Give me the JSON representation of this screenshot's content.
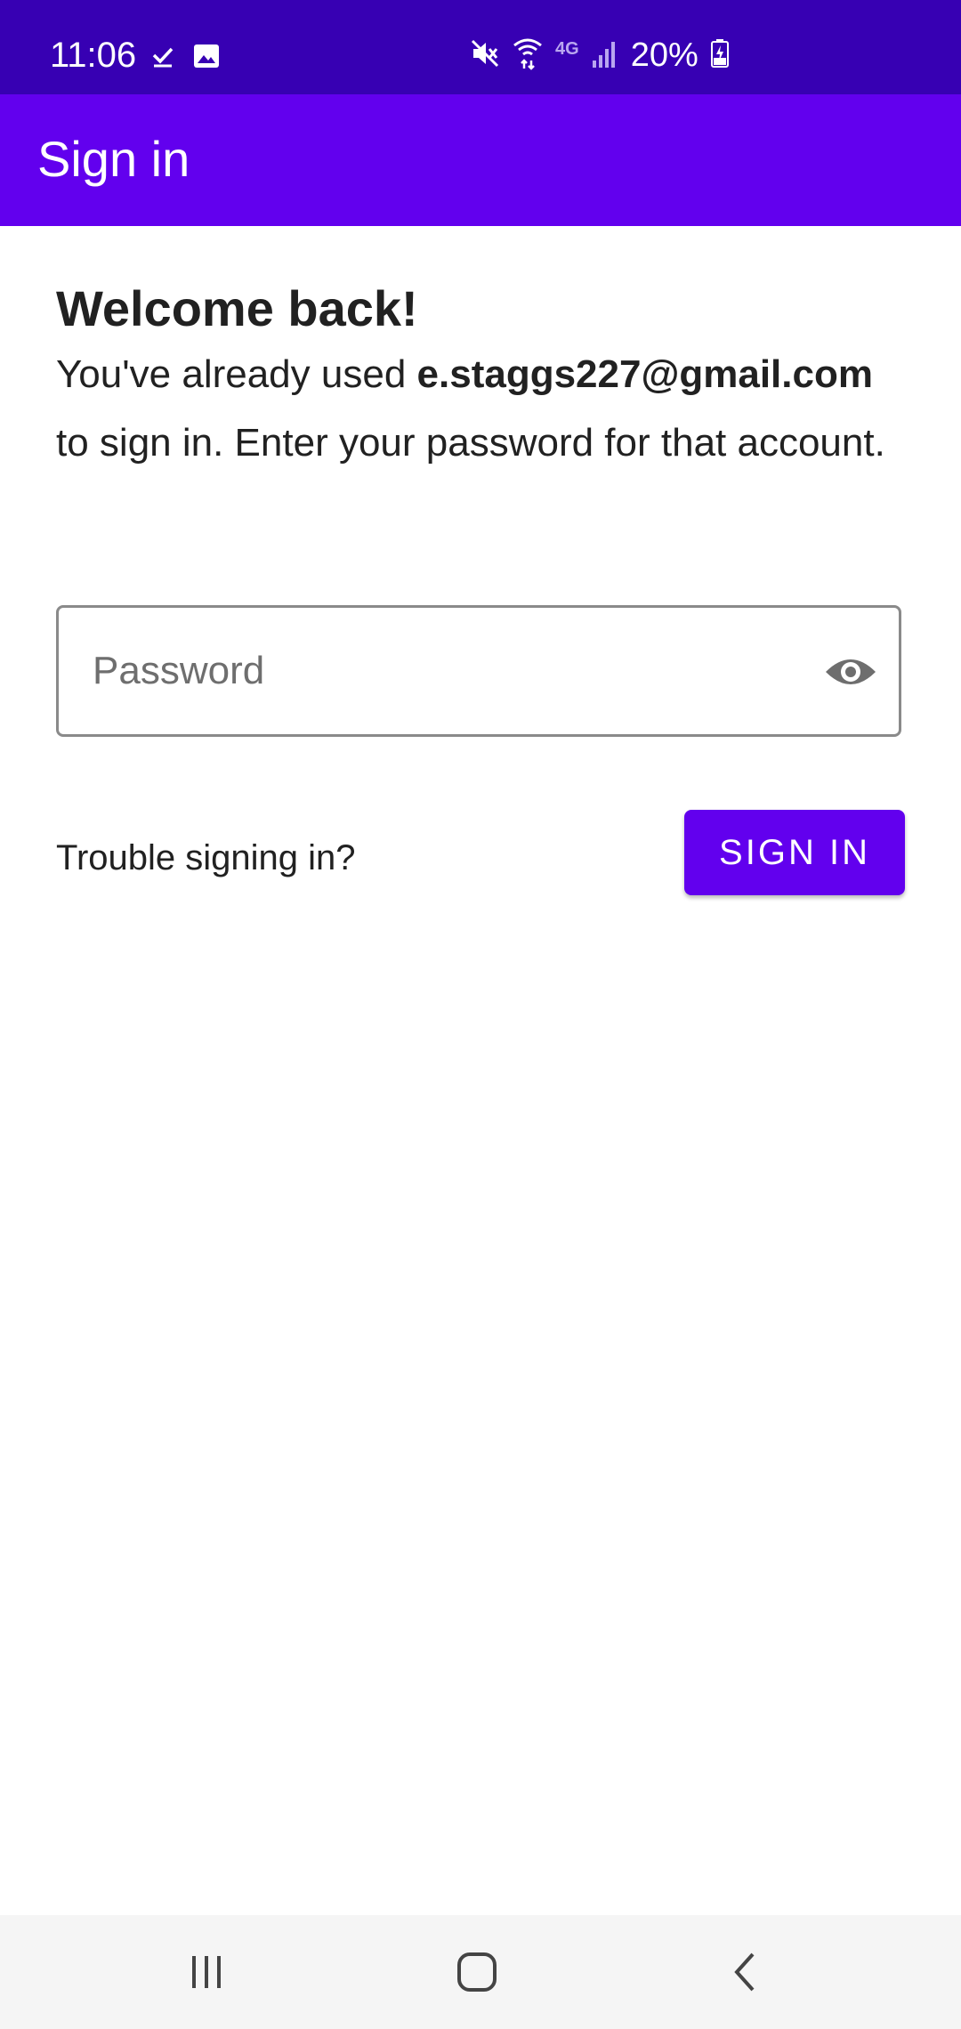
{
  "status_bar": {
    "time": "11:06",
    "battery_percent": "20%",
    "network_label": "4G",
    "icons": [
      "check-icon",
      "image-icon",
      "mute-icon",
      "wifi-icon",
      "network-4g-icon",
      "signal-icon",
      "battery-charging-icon"
    ]
  },
  "app_bar": {
    "title": "Sign in"
  },
  "main": {
    "welcome_title": "Welcome back!",
    "body_prefix": "You've already used ",
    "email": "e.staggs227@gmail.com",
    "body_suffix": " to sign in. Enter your password for that account.",
    "password_placeholder": "Password",
    "password_value": "",
    "trouble_link": "Trouble signing in?",
    "sign_in_button": "SIGN IN"
  },
  "nav_bar": {
    "buttons": [
      "recent-apps",
      "home",
      "back"
    ]
  },
  "colors": {
    "status_bar": "#3700b3",
    "primary": "#6200ee",
    "text": "#212121",
    "nav_bar": "#f5f5f5"
  }
}
